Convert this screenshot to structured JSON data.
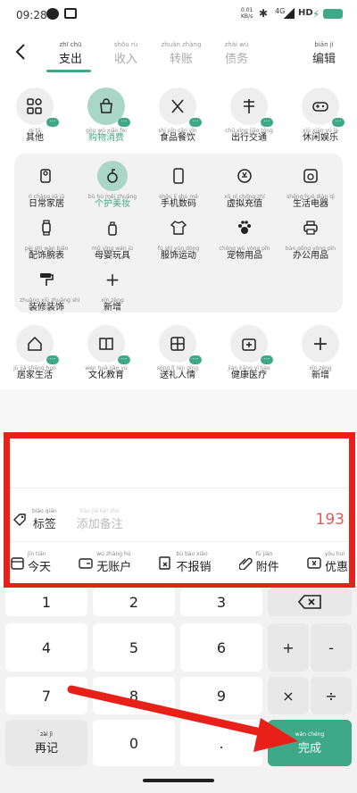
{
  "status": {
    "time": "09:28",
    "speed": "0.01\nKB/s",
    "net": "4G",
    "hd": "HD"
  },
  "tabs": [
    {
      "py": "zhī chū",
      "label": "支出"
    },
    {
      "py": "shōu rù",
      "label": "收入"
    },
    {
      "py": "zhuǎn zhàng",
      "label": "转账"
    },
    {
      "py": "zhài wù",
      "label": "债务"
    }
  ],
  "edit": {
    "py": "biān jí",
    "label": "编辑"
  },
  "categories_row1": [
    {
      "py": "qí tā",
      "label": "其他",
      "icon": "grid-icon"
    },
    {
      "py": "gòu wù xiāo fèi",
      "label": "购物消费",
      "icon": "shopping-bag-icon"
    },
    {
      "py": "shí pǐn cān yǐn",
      "label": "食品餐饮",
      "icon": "fork-knife-icon"
    },
    {
      "py": "chū xíng jiāo tōng",
      "label": "出行交通",
      "icon": "signpost-icon"
    },
    {
      "py": "xiū xián yú lè",
      "label": "休闲娱乐",
      "icon": "gamepad-icon"
    }
  ],
  "subcategories": [
    {
      "py": "rì cháng jiā jū",
      "label": "日常家居",
      "icon": "toilet-paper-icon"
    },
    {
      "py": "bù hù měi zhuāng",
      "label": "个护美妆",
      "icon": "cosmetics-icon"
    },
    {
      "py": "shǒu jī shù mǎ",
      "label": "手机数码",
      "icon": "phone-icon"
    },
    {
      "py": "xū nǐ chōng zhí",
      "label": "虚拟充值",
      "icon": "recharge-icon"
    },
    {
      "py": "shēng huó diàn qì",
      "label": "生活电器",
      "icon": "appliance-icon"
    },
    {
      "py": "pèi shì wàn biǎo",
      "label": "配饰腕表",
      "icon": "watch-icon"
    },
    {
      "py": "mǔ yīng wán jù",
      "label": "母婴玩具",
      "icon": "baby-bottle-icon"
    },
    {
      "py": "fú shì yùn dòng",
      "label": "服饰运动",
      "icon": "clothes-icon"
    },
    {
      "py": "chǒng wù yòng pǐn",
      "label": "宠物用品",
      "icon": "paw-icon"
    },
    {
      "py": "bàn gōng yòng pǐn",
      "label": "办公用品",
      "icon": "printer-icon"
    },
    {
      "py": "zhuāng xiū zhuāng shì",
      "label": "装修装饰",
      "icon": "paint-roller-icon"
    },
    {
      "py": "xīn zēng",
      "label": "新增",
      "icon": "plus-icon"
    }
  ],
  "categories_row2": [
    {
      "py": "jū jiā shēng huó",
      "label": "居家生活",
      "icon": "house-icon"
    },
    {
      "py": "wén huà jiào yù",
      "label": "文化教育",
      "icon": "book-icon"
    },
    {
      "py": "sòng lǐ rén qíng",
      "label": "送礼人情",
      "icon": "gift-icon"
    },
    {
      "py": "jiàn kāng yī liáo",
      "label": "健康医疗",
      "icon": "medical-kit-icon"
    },
    {
      "py": "xīn zēng",
      "label": "新增",
      "icon": "plus-icon"
    }
  ],
  "entry": {
    "tag_py": "biāo qiān",
    "tag_label": "标签",
    "note_py": "tiān jiā bèi zhù",
    "note_placeholder": "添加备注",
    "amount": "193"
  },
  "options": [
    {
      "py": "jīn tiān",
      "label": "今天",
      "icon": "calendar-icon"
    },
    {
      "py": "wú zhàng hù",
      "label": "无账户",
      "icon": "wallet-icon"
    },
    {
      "py": "bù bào xiāo",
      "label": "不报销",
      "icon": "no-reimburse-icon"
    },
    {
      "py": "fù jiàn",
      "label": "附件",
      "icon": "paperclip-icon"
    },
    {
      "py": "yōu huì",
      "label": "优惠",
      "icon": "coupon-icon"
    }
  ],
  "keys": {
    "k1": "1",
    "k2": "2",
    "k3": "3",
    "k4": "4",
    "k5": "5",
    "k6": "6",
    "k7": "7",
    "k8": "8",
    "k9": "9",
    "k0": "0",
    "dot": ".",
    "plus": "+",
    "minus": "-",
    "times": "×",
    "divide": "÷",
    "again_py": "zài jì",
    "again": "再记",
    "done_py": "wán chéng",
    "done": "完成"
  },
  "colors": {
    "accent": "#3fa886",
    "highlight_box": "#e8201a",
    "amount": "#e05a5a"
  }
}
